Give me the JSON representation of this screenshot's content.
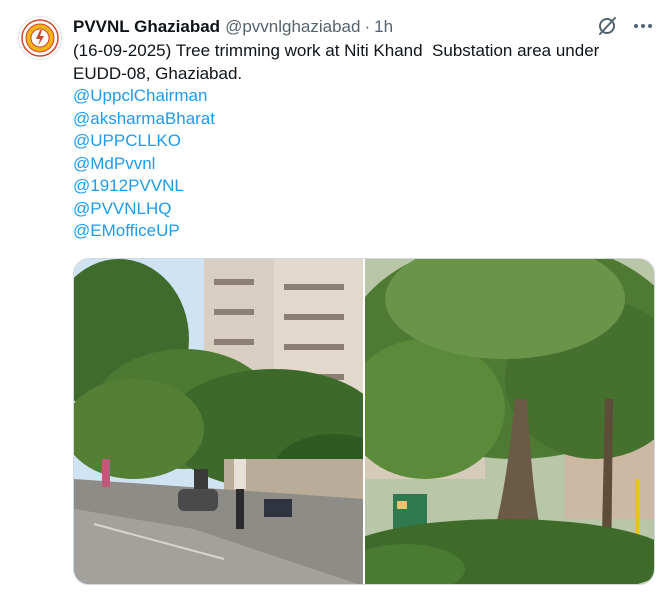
{
  "author": {
    "name": "PVVNL Ghaziabad",
    "handle": "@pvvnlghaziabad",
    "separator": "·",
    "time": "1h"
  },
  "post": {
    "text_line1": "(16-09-2025) Tree trimming work at Niti Khand  Substation area under",
    "text_line2": "EUDD-08, Ghaziabad.",
    "mentions": [
      "@UppclChairman",
      "@aksharmaBharat",
      "@UPPCLLKO",
      "@MdPvvnl",
      "@1912PVVNL",
      "@PVVNLHQ",
      "@EMofficeUP"
    ]
  },
  "icons": {
    "avatar": "pvvnl-logo",
    "grok": "slashed-circle-icon",
    "more": "more-icon"
  },
  "colors": {
    "link": "#1d9bf0",
    "secondary_text": "#536471",
    "primary_text": "#0f1419"
  }
}
